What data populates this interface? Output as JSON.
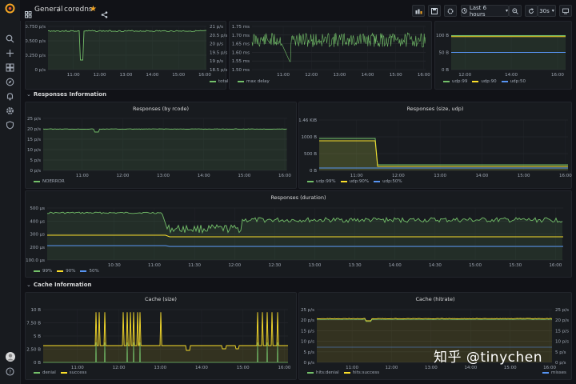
{
  "app": {
    "folder": "General",
    "separator": "/",
    "dashboard": "coredns",
    "time_range": "Last 6 hours",
    "refresh": "30s",
    "accent": "#f5a623"
  },
  "sidebar": {
    "icons": [
      "grafana-logo-icon",
      "search-icon",
      "plus-icon",
      "dashboards-icon",
      "explore-icon",
      "alerting-icon",
      "gear-icon",
      "shield-icon",
      "avatar-icon",
      "help-icon"
    ]
  },
  "rows": {
    "responses": "Responses Information",
    "cache": "Cache Information"
  },
  "panels": {
    "top_left": {
      "title": "",
      "legend": [
        "total"
      ]
    },
    "top_mid": {
      "title": "",
      "legend": [
        "max delay"
      ]
    },
    "top_right": {
      "title": "",
      "legend": [
        "udp:99",
        "udp:90",
        "udp:50"
      ]
    },
    "resp_rcode": {
      "title": "Responses (by rcode)",
      "legend": [
        "NOERROR"
      ]
    },
    "resp_size": {
      "title": "Responses (size, udp)",
      "legend": [
        "udp:99%",
        "udp:90%",
        "udp:50%"
      ]
    },
    "resp_duration": {
      "title": "Responses (duration)",
      "legend": [
        "99%",
        "90%",
        "50%"
      ]
    },
    "cache_size": {
      "title": "Cache (size)",
      "legend": [
        "denial",
        "success"
      ]
    },
    "cache_hitrate": {
      "title": "Cache (hitrate)",
      "legend": [
        "hits:denial",
        "hits:success",
        "misses"
      ]
    }
  },
  "watermark": "知乎 @tinychen",
  "chart_data": [
    {
      "type": "line",
      "id": "top_left",
      "title": "",
      "x": [
        "11:00",
        "12:00",
        "13:00",
        "14:00",
        "15:00",
        "16:00"
      ],
      "yticks_left": [
        "0 p/s",
        "0.250 p/s",
        "0.500 p/s",
        "0.750 p/s"
      ],
      "yticks_right": [
        "18.5 p/s",
        "19 p/s",
        "19.5 p/s",
        "20 p/s",
        "20.5 p/s",
        "21 p/s"
      ],
      "series": [
        {
          "name": "total",
          "color": "#73bf69",
          "approx_value": "0.730 p/s"
        }
      ]
    },
    {
      "type": "line",
      "id": "top_mid",
      "title": "",
      "x": [
        "11:00",
        "12:00",
        "13:00",
        "14:00",
        "15:00",
        "16:00"
      ],
      "yticks": [
        "1.50 ms",
        "1.55 ms",
        "1.60 ms",
        "1.65 ms",
        "1.70 ms",
        "1.75 ms"
      ],
      "series": [
        {
          "name": "max delay",
          "color": "#73bf69"
        }
      ]
    },
    {
      "type": "line",
      "id": "top_right",
      "title": "",
      "x": [
        "12:00",
        "14:00",
        "16:00"
      ],
      "yticks": [
        "0 B",
        "50 B",
        "100 B"
      ],
      "series": [
        {
          "name": "udp:99",
          "color": "#73bf69",
          "value": "100 B"
        },
        {
          "name": "udp:90",
          "color": "#fade2a",
          "value": "100 B"
        },
        {
          "name": "udp:50",
          "color": "#5794f2",
          "value": "50 B"
        }
      ]
    },
    {
      "type": "line",
      "id": "resp_rcode",
      "title": "Responses (by rcode)",
      "x": [
        "11:00",
        "12:00",
        "13:00",
        "14:00",
        "15:00",
        "16:00"
      ],
      "yticks": [
        "0 p/s",
        "5 p/s",
        "10 p/s",
        "15 p/s",
        "20 p/s",
        "25 p/s"
      ],
      "series": [
        {
          "name": "NOERROR",
          "color": "#73bf69",
          "approx_value": "21 p/s"
        }
      ]
    },
    {
      "type": "line",
      "id": "resp_size",
      "title": "Responses (size, udp)",
      "x": [
        "11:00",
        "12:00",
        "13:00",
        "14:00",
        "15:00",
        "16:00"
      ],
      "yticks": [
        "0 B",
        "500 B",
        "1000 B",
        "1.46 KiB"
      ],
      "series": [
        {
          "name": "udp:99%",
          "color": "#73bf69"
        },
        {
          "name": "udp:90%",
          "color": "#fade2a"
        },
        {
          "name": "udp:50%",
          "color": "#5794f2"
        }
      ]
    },
    {
      "type": "line",
      "id": "resp_duration",
      "title": "Responses (duration)",
      "x": [
        "10:30",
        "11:00",
        "11:30",
        "12:00",
        "12:30",
        "13:00",
        "13:30",
        "14:00",
        "14:30",
        "15:00",
        "15:30",
        "16:00"
      ],
      "yticks": [
        "100.0 µs",
        "200 µs",
        "300 µs",
        "400 µs",
        "500 µs"
      ],
      "series": [
        {
          "name": "99%",
          "color": "#73bf69"
        },
        {
          "name": "90%",
          "color": "#fade2a"
        },
        {
          "name": "50%",
          "color": "#5794f2"
        }
      ]
    },
    {
      "type": "line",
      "id": "cache_size",
      "title": "Cache (size)",
      "x": [
        "11:00",
        "12:00",
        "13:00",
        "14:00",
        "15:00",
        "16:00"
      ],
      "yticks": [
        "0 B",
        "2.50 B",
        "5 B",
        "7.50 B",
        "10 B"
      ],
      "series": [
        {
          "name": "denial",
          "color": "#73bf69"
        },
        {
          "name": "success",
          "color": "#fade2a"
        }
      ]
    },
    {
      "type": "line",
      "id": "cache_hitrate",
      "title": "Cache (hitrate)",
      "x": [
        "11:00",
        "12:00",
        "13:00",
        "14:00",
        "15:00",
        "16:00"
      ],
      "yticks_left": [
        "0 p/s",
        "5 p/s",
        "10 p/s",
        "15 p/s",
        "20 p/s",
        "25 p/s"
      ],
      "yticks_right": [
        "0 p/s",
        "5 p/s",
        "10 p/s",
        "15 p/s",
        "20 p/s",
        "25 p/s"
      ],
      "series": [
        {
          "name": "hits:denial",
          "color": "#73bf69"
        },
        {
          "name": "hits:success",
          "color": "#fade2a"
        },
        {
          "name": "misses",
          "color": "#5794f2"
        }
      ]
    }
  ]
}
